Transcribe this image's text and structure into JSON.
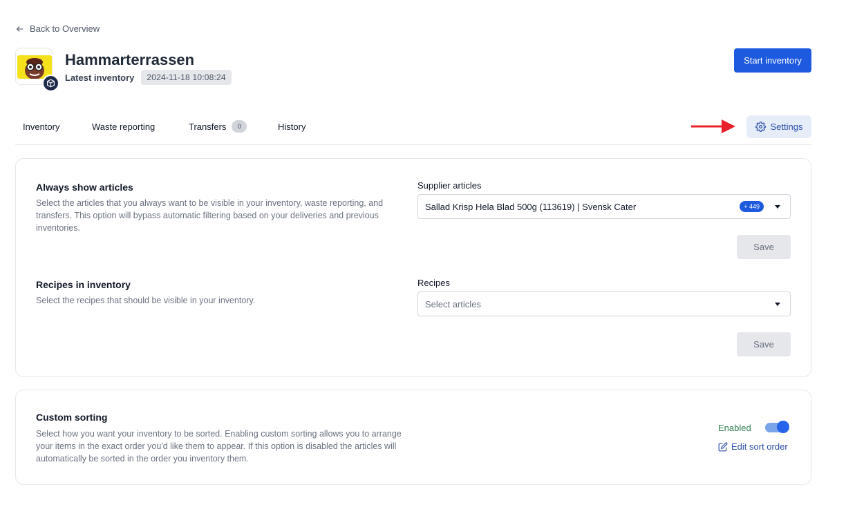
{
  "nav": {
    "back_label": "Back to Overview"
  },
  "header": {
    "title": "Hammarterrassen",
    "latest_label": "Latest inventory",
    "latest_date": "2024-11-18 10:08:24",
    "start_button": "Start inventory"
  },
  "tabs": [
    {
      "label": "Inventory"
    },
    {
      "label": "Waste reporting"
    },
    {
      "label": "Transfers",
      "count": "0"
    },
    {
      "label": "History"
    }
  ],
  "settings_button": "Settings",
  "articles": {
    "title": "Always show articles",
    "description": "Select the articles that you always want to be visible in your inventory, waste reporting, and transfers. This option will bypass automatic filtering based on your deliveries and previous inventories.",
    "field_label": "Supplier articles",
    "selected": "Sallad Krisp Hela Blad 500g (113619) | Svensk Cater",
    "more_count": "+ 449",
    "save": "Save"
  },
  "recipes": {
    "title": "Recipes in inventory",
    "description": "Select the recipes that should be visible in your inventory.",
    "field_label": "Recipes",
    "placeholder": "Select articles",
    "save": "Save"
  },
  "sorting": {
    "title": "Custom sorting",
    "description": "Select how you want your inventory to be sorted. Enabling custom sorting allows you to arrange your items in the exact order you'd like them to appear. If this option is disabled the articles will automatically be sorted in the order you inventory them.",
    "status": "Enabled",
    "edit_link": "Edit sort order"
  },
  "colors": {
    "primary": "#1d5ae0",
    "annotation_arrow": "#e8202a",
    "enabled_text": "#2f7d4f"
  },
  "icons": [
    "arrow-left-icon",
    "cube-icon",
    "gear-icon",
    "edit-icon",
    "chevron-down-icon"
  ]
}
